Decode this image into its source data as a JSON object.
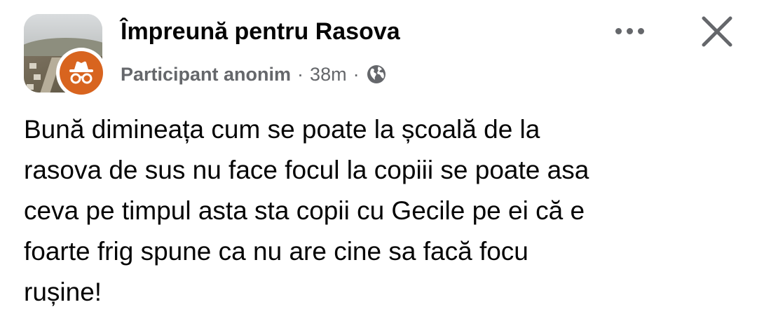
{
  "post": {
    "group_name": "Împreună pentru Rasova",
    "author": "Participant anonim",
    "separator": "·",
    "time": "38m",
    "audience_icon": "globe-icon",
    "avatar_icon": "incognito-icon",
    "more_icon": "more-options-icon",
    "close_icon": "close-icon",
    "text": "Bună dimineața cum se poate la școală de la\nrasova de sus nu face focul la copiii se poate asa\nceva pe timpul asta sta copii cu Gecile pe ei că e\nfoarte frig spune ca nu are cine sa facă focu\nrușine!"
  },
  "colors": {
    "text_primary": "#050505",
    "text_secondary": "#65676b",
    "anon_avatar": "#d8641f",
    "background": "#ffffff"
  }
}
